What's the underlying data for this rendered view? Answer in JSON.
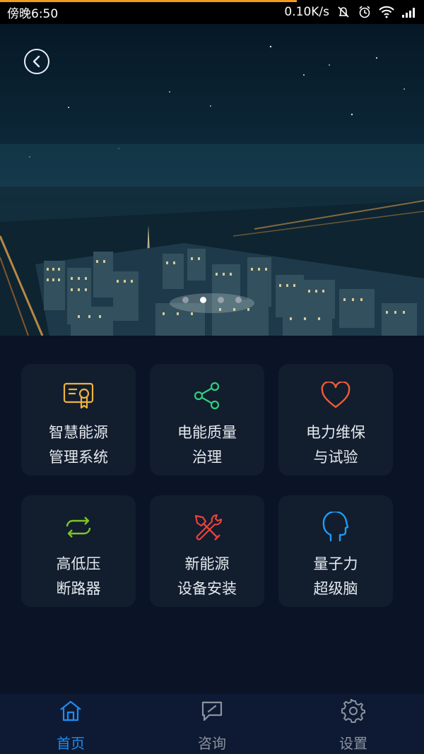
{
  "status_bar": {
    "time": "傍晚6:50",
    "speed": "0.10K/s",
    "icons": [
      "mute-icon",
      "alarm-icon",
      "wifi-icon",
      "signal-icon"
    ]
  },
  "hero": {
    "back_icon": "chevron-left-icon",
    "carousel": {
      "count": 4,
      "active_index": 1
    }
  },
  "features": [
    {
      "label": "智慧能源\n管理系统",
      "icon": "certificate-icon",
      "color": "#f0b33a"
    },
    {
      "label": "电能质量\n治理",
      "icon": "share-icon",
      "color": "#2fcf7e"
    },
    {
      "label": "电力维保\n与试验",
      "icon": "heart-icon",
      "color": "#ef5b36"
    },
    {
      "label": "高低压\n断路器",
      "icon": "refresh-arrows-icon",
      "color": "#7ec326"
    },
    {
      "label": "新能源\n设备安装",
      "icon": "tools-icon",
      "color": "#e8423c"
    },
    {
      "label": "量子力\n超级脑",
      "icon": "head-icon",
      "color": "#1f9cf0"
    }
  ],
  "bottom_nav": {
    "active": "home",
    "items": [
      {
        "label": "首页",
        "icon": "home-icon"
      },
      {
        "label": "咨询",
        "icon": "chat-icon"
      },
      {
        "label": "设置",
        "icon": "gear-icon"
      }
    ],
    "active_color": "#1f8cf0",
    "inactive_color": "#8b93a0"
  }
}
